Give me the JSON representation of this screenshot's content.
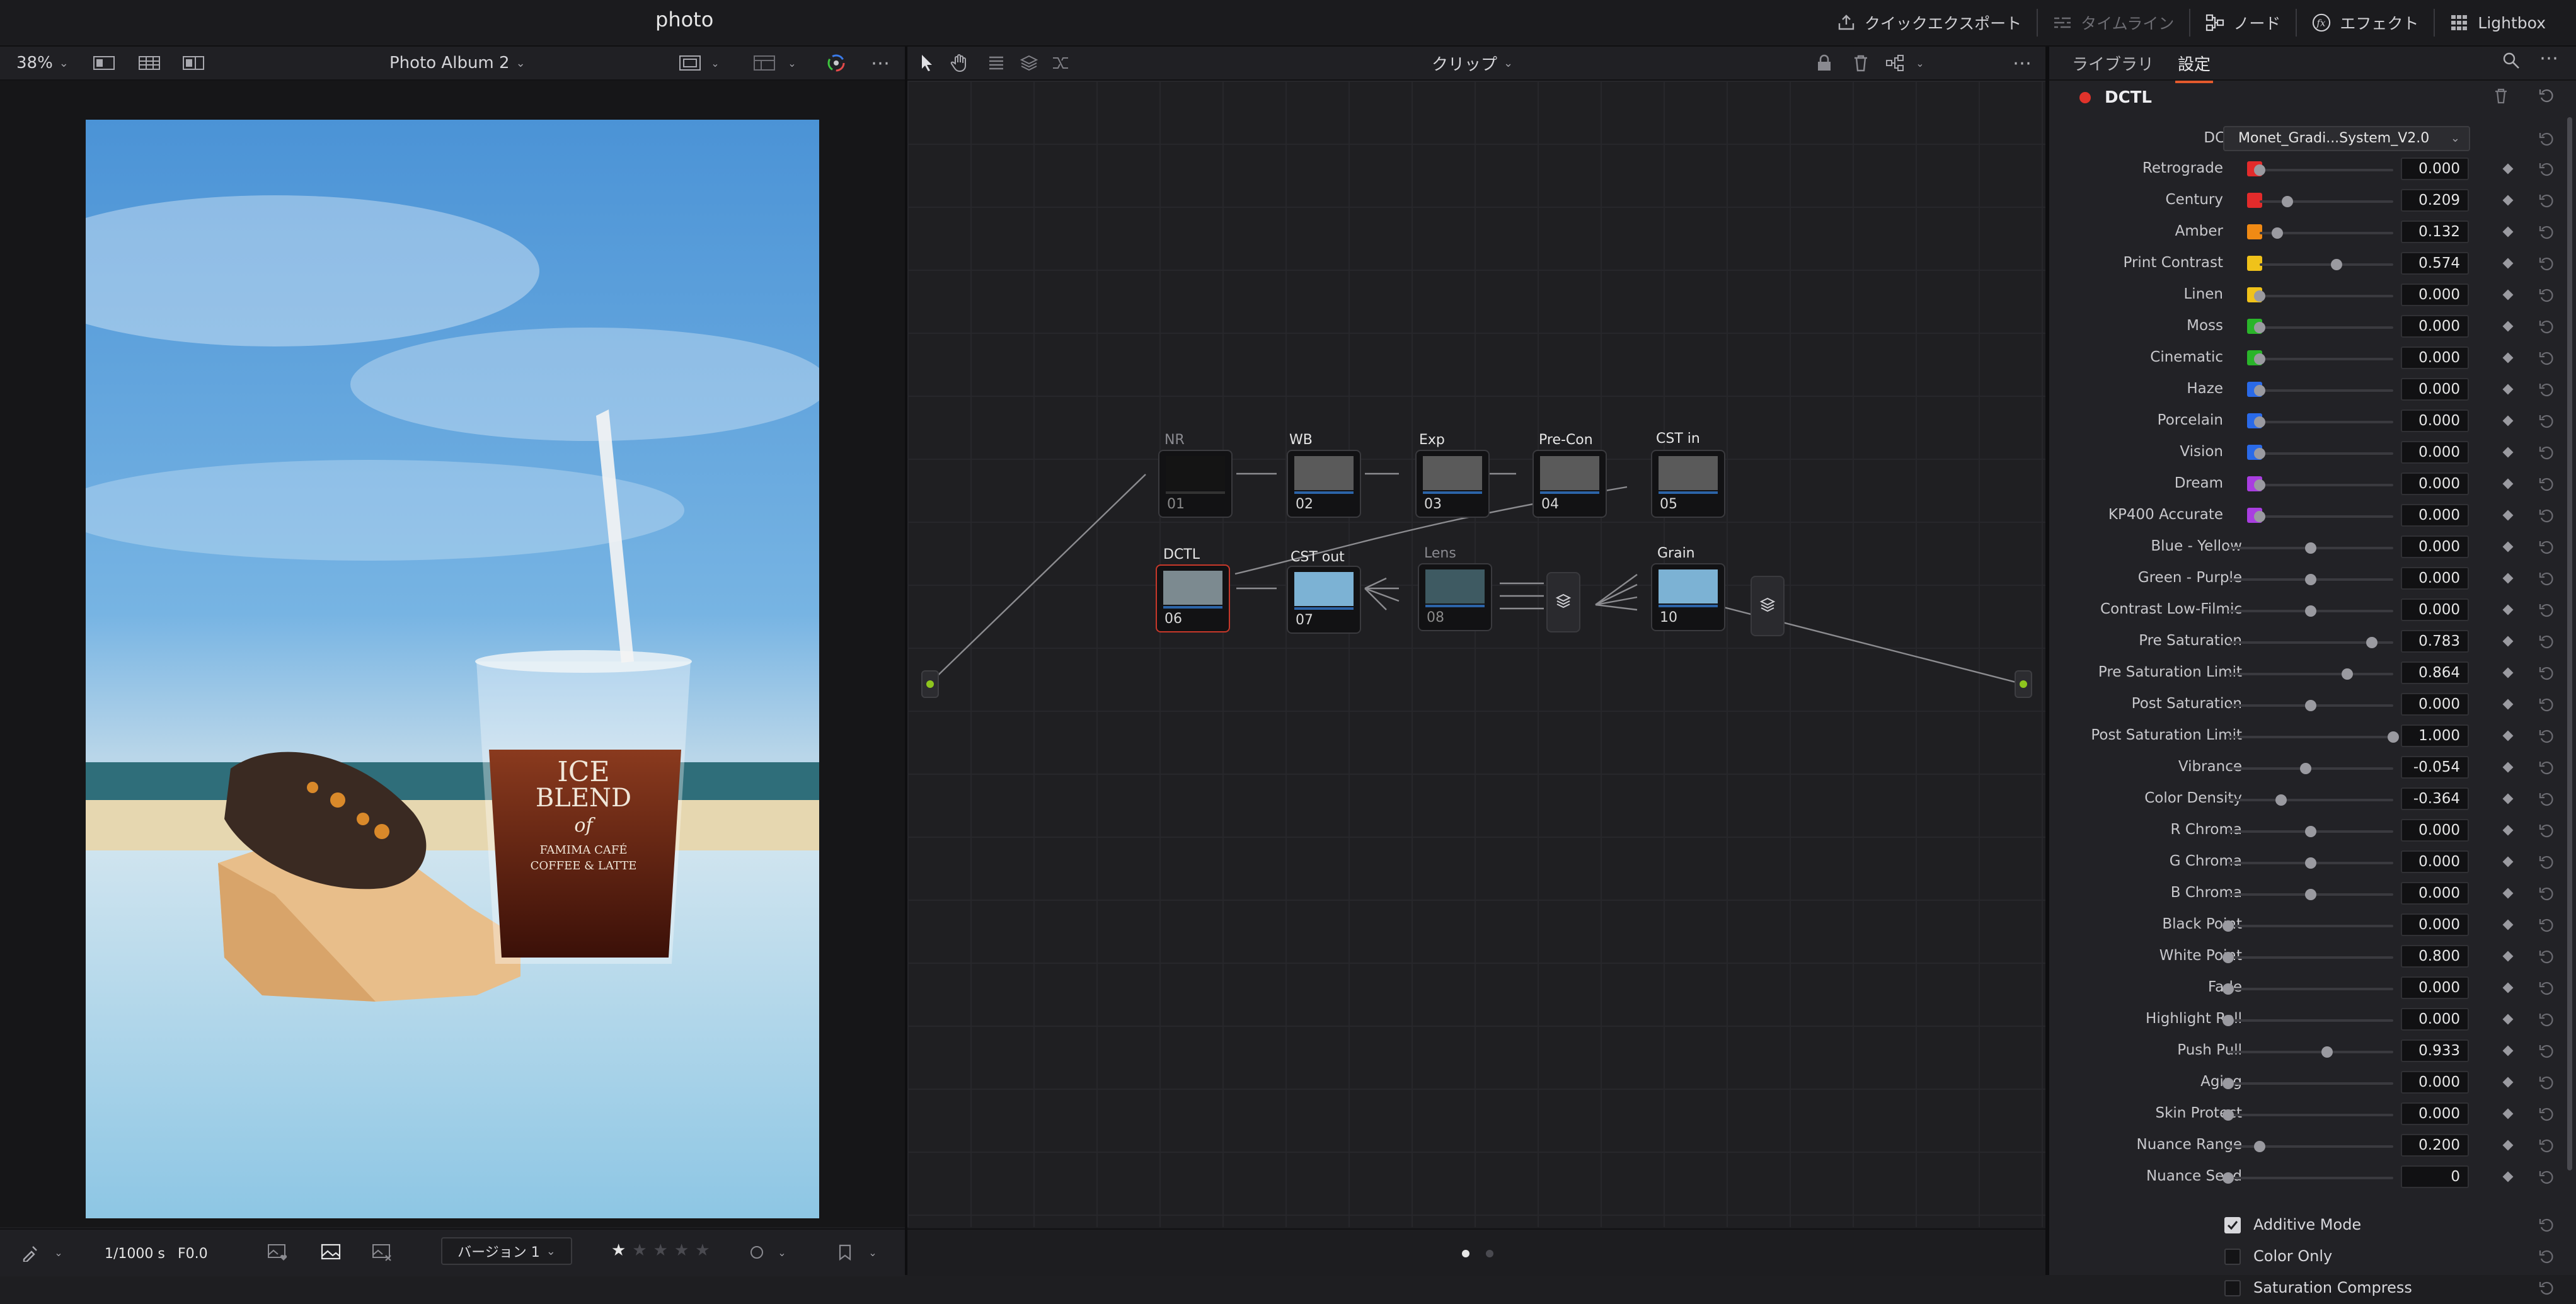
{
  "app": {
    "title": "photo"
  },
  "topbar": {
    "quick_export": "クイックエクスポート",
    "timeline": "タイムライン",
    "nodes": "ノード",
    "effects": "エフェクト",
    "lightbox": "Lightbox"
  },
  "viewer_header": {
    "zoom": "38%",
    "album": "Photo Album 2"
  },
  "node_header": {
    "mode": "クリップ"
  },
  "viewer_footer": {
    "shutter": "1/1000 s",
    "aperture": "F0.0",
    "version": "バージョン 1",
    "rating_stars": 1,
    "rating_max": 5
  },
  "nodes": {
    "labels": {
      "nr": "NR",
      "wb": "WB",
      "exp": "Exp",
      "precon": "Pre-Con",
      "cstin": "CST in",
      "dctl": "DCTL",
      "cstout": "CST out",
      "lens": "Lens",
      "grain": "Grain"
    },
    "numbers": {
      "n01": "01",
      "n02": "02",
      "n03": "03",
      "n04": "04",
      "n05": "05",
      "n06": "06",
      "n07": "07",
      "n08": "08",
      "n10": "10"
    }
  },
  "right_panel": {
    "tabs": {
      "library": "ライブラリ",
      "settings": "設定"
    },
    "effect_title": "DCTL",
    "dctl_label": "DCTL",
    "dctl_selected": "Monet_Gradi...System_V2.0",
    "params": [
      {
        "label": "Retrograde",
        "value": "0.000",
        "swatch": "#e32b2b",
        "pos": 0.0
      },
      {
        "label": "Century",
        "value": "0.209",
        "swatch": "#e32b2b",
        "pos": 0.209
      },
      {
        "label": "Amber",
        "value": "0.132",
        "swatch": "#f08a14",
        "pos": 0.132
      },
      {
        "label": "Print Contrast",
        "value": "0.574",
        "swatch": "#f0c21a",
        "pos": 0.574
      },
      {
        "label": "Linen",
        "value": "0.000",
        "swatch": "#f0c21a",
        "pos": 0.0
      },
      {
        "label": "Moss",
        "value": "0.000",
        "swatch": "#2ab52a",
        "pos": 0.0
      },
      {
        "label": "Cinematic",
        "value": "0.000",
        "swatch": "#2ab52a",
        "pos": 0.0
      },
      {
        "label": "Haze",
        "value": "0.000",
        "swatch": "#2a6ae8",
        "pos": 0.0
      },
      {
        "label": "Porcelain",
        "value": "0.000",
        "swatch": "#2a6ae8",
        "pos": 0.0
      },
      {
        "label": "Vision",
        "value": "0.000",
        "swatch": "#2a6ae8",
        "pos": 0.0
      },
      {
        "label": "Dream",
        "value": "0.000",
        "swatch": "#a93ee0",
        "pos": 0.0
      },
      {
        "label": "KP400 Accurate",
        "value": "0.000",
        "swatch": "#a93ee0",
        "pos": 0.0
      },
      {
        "label": "Blue - Yellow",
        "value": "0.000",
        "swatch": "",
        "pos": 0.5
      },
      {
        "label": "Green - Purple",
        "value": "0.000",
        "swatch": "",
        "pos": 0.5
      },
      {
        "label": "Contrast Low-Filmic",
        "value": "0.000",
        "swatch": "",
        "pos": 0.5
      },
      {
        "label": "Pre Saturation",
        "value": "0.783",
        "swatch": "",
        "pos": 0.87
      },
      {
        "label": "Pre Saturation Limit",
        "value": "0.864",
        "swatch": "",
        "pos": 0.72
      },
      {
        "label": "Post Saturation",
        "value": "0.000",
        "swatch": "",
        "pos": 0.5
      },
      {
        "label": "Post Saturation Limit",
        "value": "1.000",
        "swatch": "",
        "pos": 1.0
      },
      {
        "label": "Vibrance",
        "value": "-0.054",
        "swatch": "",
        "pos": 0.47
      },
      {
        "label": "Color Density",
        "value": "-0.364",
        "swatch": "",
        "pos": 0.32
      },
      {
        "label": "R Chroma",
        "value": "0.000",
        "swatch": "",
        "pos": 0.5
      },
      {
        "label": "G Chroma",
        "value": "0.000",
        "swatch": "",
        "pos": 0.5
      },
      {
        "label": "B Chroma",
        "value": "0.000",
        "swatch": "",
        "pos": 0.5
      },
      {
        "label": "Black Point",
        "value": "0.000",
        "swatch": "",
        "pos": 0.0
      },
      {
        "label": "White Point",
        "value": "0.800",
        "swatch": "",
        "pos": 0.0
      },
      {
        "label": "Fade",
        "value": "0.000",
        "swatch": "",
        "pos": 0.0
      },
      {
        "label": "Highlight Roll",
        "value": "0.000",
        "swatch": "",
        "pos": 0.0
      },
      {
        "label": "Push Pull",
        "value": "0.933",
        "swatch": "",
        "pos": 0.6
      },
      {
        "label": "Aging",
        "value": "0.000",
        "swatch": "",
        "pos": 0.0
      },
      {
        "label": "Skin Protect",
        "value": "0.000",
        "swatch": "",
        "pos": 0.0
      },
      {
        "label": "Nuance Range",
        "value": "0.200",
        "swatch": "",
        "pos": 0.19
      },
      {
        "label": "Nuance Seed",
        "value": "0",
        "swatch": "",
        "pos": 0.0
      }
    ],
    "checkboxes": [
      {
        "label": "Additive Mode",
        "checked": true
      },
      {
        "label": "Color Only",
        "checked": false
      },
      {
        "label": "Saturation Compress",
        "checked": false
      }
    ]
  }
}
